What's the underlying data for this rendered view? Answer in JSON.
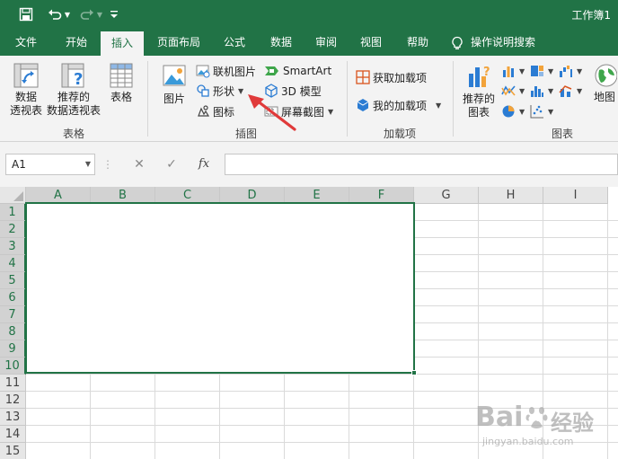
{
  "window": {
    "title": "工作簿1"
  },
  "tabs": [
    "文件",
    "开始",
    "插入",
    "页面布局",
    "公式",
    "数据",
    "审阅",
    "视图",
    "帮助"
  ],
  "active_tab": "插入",
  "tell_me": "操作说明搜索",
  "ribbon": {
    "tables": {
      "label": "表格",
      "pivot_table": "数据\n透视表",
      "recommended_pivot": "推荐的\n数据透视表",
      "table": "表格"
    },
    "illustrations": {
      "label": "插图",
      "pictures": "图片",
      "online_pictures": "联机图片",
      "shapes": "形状",
      "icons": "图标",
      "smartart": "SmartArt",
      "model_3d": "3D 模型",
      "screenshot": "屏幕截图"
    },
    "addins": {
      "label": "加载项",
      "get_addins": "获取加载项",
      "my_addins": "我的加载项"
    },
    "charts": {
      "label": "图表",
      "recommended_charts": "推荐的\n图表",
      "maps": "地图"
    }
  },
  "formula_bar": {
    "name_box": "A1",
    "cancel": "✕",
    "enter": "✓",
    "fx": "fx"
  },
  "grid": {
    "columns": [
      "A",
      "B",
      "C",
      "D",
      "E",
      "F",
      "G",
      "H",
      "I"
    ],
    "rows": [
      "1",
      "2",
      "3",
      "4",
      "5",
      "6",
      "7",
      "8",
      "9",
      "10",
      "11",
      "12",
      "13",
      "14",
      "15"
    ]
  },
  "watermark": {
    "brand": "Bai",
    "paw": "du",
    "cn": "经验",
    "url": "jingyan.baidu.com"
  },
  "colors": {
    "accent": "#217346",
    "arrow": "#e03a3a"
  }
}
